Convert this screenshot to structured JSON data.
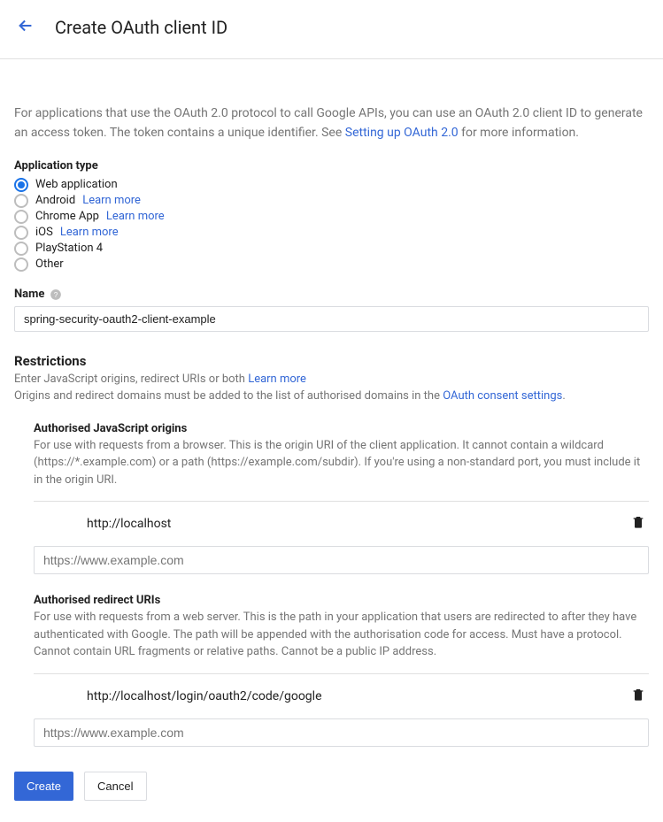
{
  "header": {
    "title": "Create OAuth client ID"
  },
  "intro": {
    "text_pre": "For applications that use the OAuth 2.0 protocol to call Google APIs, you can use an OAuth 2.0 client ID to generate an access token. The token contains a unique identifier. See ",
    "link": "Setting up OAuth 2.0",
    "text_post": " for more information."
  },
  "app_type": {
    "label": "Application type",
    "options": [
      {
        "label": "Web application",
        "selected": true,
        "learn_more": false
      },
      {
        "label": "Android",
        "selected": false,
        "learn_more": true
      },
      {
        "label": "Chrome App",
        "selected": false,
        "learn_more": true
      },
      {
        "label": "iOS",
        "selected": false,
        "learn_more": true
      },
      {
        "label": "PlayStation 4",
        "selected": false,
        "learn_more": false
      },
      {
        "label": "Other",
        "selected": false,
        "learn_more": false
      }
    ],
    "learn_more_text": "Learn more"
  },
  "name": {
    "label": "Name",
    "value": "spring-security-oauth2-client-example"
  },
  "restrictions": {
    "title": "Restrictions",
    "desc_pre": "Enter JavaScript origins, redirect URIs or both ",
    "desc_link": "Learn more",
    "note_pre": "Origins and redirect domains must be added to the list of authorised domains in the ",
    "note_link": "OAuth consent settings",
    "note_post": "."
  },
  "js_origins": {
    "title": "Authorised JavaScript origins",
    "desc": "For use with requests from a browser. This is the origin URI of the client application. It cannot contain a wildcard (https://*.example.com) or a path (https://example.com/subdir). If you're using a non-standard port, you must include it in the origin URI.",
    "entries": [
      "http://localhost"
    ],
    "placeholder": "https://www.example.com"
  },
  "redirect_uris": {
    "title": "Authorised redirect URIs",
    "desc": "For use with requests from a web server. This is the path in your application that users are redirected to after they have authenticated with Google. The path will be appended with the authorisation code for access. Must have a protocol. Cannot contain URL fragments or relative paths. Cannot be a public IP address.",
    "entries": [
      "http://localhost/login/oauth2/code/google"
    ],
    "placeholder": "https://www.example.com"
  },
  "buttons": {
    "create": "Create",
    "cancel": "Cancel"
  }
}
